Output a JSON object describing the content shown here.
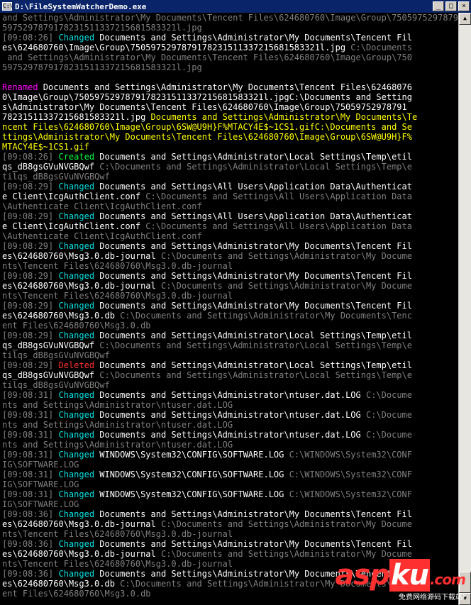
{
  "window": {
    "icon_text": "C:\\",
    "title": "D:\\FileSystemWatcherDemo.exe",
    "minimize": "_",
    "maximize": "□",
    "close": "×"
  },
  "colors": {
    "gray": "#808080",
    "white": "#ffffff",
    "cyan": "#00e0e0",
    "green": "#00ff40",
    "red": "#ff3030",
    "yellow": "#ffff00",
    "magenta": "#ff00ff"
  },
  "console_lines": [
    [
      [
        "gray",
        "and Settings\\Administrator\\My Documents\\Tencent Files\\624680760\\Image\\Group\\7505975297879178231511337215681583321"
      ]
    ],
    [
      [
        "gray",
        "5975297879178231511337215681583321l.jpg"
      ]
    ],
    [
      [
        "gray",
        "[09:08:26] "
      ],
      [
        "cyan",
        "Changed "
      ],
      [
        "white",
        "Documents and Settings\\Administrator\\My Documents\\Tencent Fil"
      ]
    ],
    [
      [
        "white",
        "es\\624680760\\Image\\Group\\7505975297879178231511337215681583321l.jpg "
      ],
      [
        "gray",
        "C:\\Documents"
      ]
    ],
    [
      [
        "gray",
        " and Settings\\Administrator\\My Documents\\Tencent Files\\624680760\\Image\\Group\\750"
      ]
    ],
    [
      [
        "gray",
        "5975297879178231511337215681583321l.jpg"
      ]
    ],
    [
      [
        "white",
        ""
      ]
    ],
    [
      [
        "magenta",
        "Renamed "
      ],
      [
        "white",
        "Documents and Settings\\Administrator\\My Documents\\Tencent Files\\62468076"
      ]
    ],
    [
      [
        "white",
        "0\\Image\\Group\\7505975297879178231511337215681583321l.jpgC:\\Documents and Setting"
      ]
    ],
    [
      [
        "white",
        "s\\Administrator\\My Documents\\Tencent Files\\624680760\\Image\\Group\\75059752978791"
      ]
    ],
    [
      [
        "white",
        "78231511337215681583321l.jpg "
      ],
      [
        "yellow",
        "Documents and Settings\\Administrator\\My Documents\\Te"
      ]
    ],
    [
      [
        "yellow",
        "ncent Files\\624680760\\Image\\Group\\6SW@U9H}F%MTACY4E$~1CS1.gifC:\\Documents and Se"
      ]
    ],
    [
      [
        "yellow",
        "ttings\\Administrator\\My Documents\\Tencent Files\\624680760\\Image\\Group\\6SW@U9H}F%"
      ]
    ],
    [
      [
        "yellow",
        "MTACY4E$~1CS1.gif"
      ]
    ],
    [
      [
        "gray",
        "[09:08:26] "
      ],
      [
        "green",
        "Created "
      ],
      [
        "white",
        "Documents and Settings\\Administrator\\Local Settings\\Temp\\etil"
      ]
    ],
    [
      [
        "white",
        "qs_dB8gsGVuNVGBQwf "
      ],
      [
        "gray",
        "C:\\Documents and Settings\\Administrator\\Local Settings\\Temp\\e"
      ]
    ],
    [
      [
        "gray",
        "tilqs_dB8gsGVuNVGBQwf"
      ]
    ],
    [
      [
        "gray",
        "[09:08:29] "
      ],
      [
        "cyan",
        "Changed "
      ],
      [
        "white",
        "Documents and Settings\\All Users\\Application Data\\Authenticat"
      ]
    ],
    [
      [
        "white",
        "e Client\\IcgAuthClient.conf "
      ],
      [
        "gray",
        "C:\\Documents and Settings\\All Users\\Application Data"
      ]
    ],
    [
      [
        "gray",
        "\\Authenticate Client\\IcgAuthClient.conf"
      ]
    ],
    [
      [
        "gray",
        "[09:08:29] "
      ],
      [
        "cyan",
        "Changed "
      ],
      [
        "white",
        "Documents and Settings\\All Users\\Application Data\\Authenticat"
      ]
    ],
    [
      [
        "white",
        "e Client\\IcgAuthClient.conf "
      ],
      [
        "gray",
        "C:\\Documents and Settings\\All Users\\Application Data"
      ]
    ],
    [
      [
        "gray",
        "\\Authenticate Client\\IcgAuthClient.conf"
      ]
    ],
    [
      [
        "gray",
        "[09:08:29] "
      ],
      [
        "cyan",
        "Changed "
      ],
      [
        "white",
        "Documents and Settings\\Administrator\\My Documents\\Tencent Fil"
      ]
    ],
    [
      [
        "white",
        "es\\624680760\\Msg3.0.db-journal "
      ],
      [
        "gray",
        "C:\\Documents and Settings\\Administrator\\My Docume"
      ]
    ],
    [
      [
        "gray",
        "nts\\Tencent Files\\624680760\\Msg3.0.db-journal"
      ]
    ],
    [
      [
        "gray",
        "[09:08:29] "
      ],
      [
        "cyan",
        "Changed "
      ],
      [
        "white",
        "Documents and Settings\\Administrator\\My Documents\\Tencent Fil"
      ]
    ],
    [
      [
        "white",
        "es\\624680760\\Msg3.0.db-journal "
      ],
      [
        "gray",
        "C:\\Documents and Settings\\Administrator\\My Docume"
      ]
    ],
    [
      [
        "gray",
        "nts\\Tencent Files\\624680760\\Msg3.0.db-journal"
      ]
    ],
    [
      [
        "gray",
        "[09:08:29] "
      ],
      [
        "cyan",
        "Changed "
      ],
      [
        "white",
        "Documents and Settings\\Administrator\\My Documents\\Tencent Fil"
      ]
    ],
    [
      [
        "white",
        "es\\624680760\\Msg3.0.db "
      ],
      [
        "gray",
        "C:\\Documents and Settings\\Administrator\\My Documents\\Tenc"
      ]
    ],
    [
      [
        "gray",
        "ent Files\\624680760\\Msg3.0.db"
      ]
    ],
    [
      [
        "gray",
        "[09:08:29] "
      ],
      [
        "cyan",
        "Changed "
      ],
      [
        "white",
        "Documents and Settings\\Administrator\\Local Settings\\Temp\\etil"
      ]
    ],
    [
      [
        "white",
        "qs_dB8gsGVuNVGBQwf "
      ],
      [
        "gray",
        "C:\\Documents and Settings\\Administrator\\Local Settings\\Temp\\e"
      ]
    ],
    [
      [
        "gray",
        "tilqs_dB8gsGVuNVGBQwf"
      ]
    ],
    [
      [
        "gray",
        "[09:08:29] "
      ],
      [
        "red",
        "Deleted "
      ],
      [
        "white",
        "Documents and Settings\\Administrator\\Local Settings\\Temp\\etil"
      ]
    ],
    [
      [
        "white",
        "qs_dB8gsGVuNVGBQwf "
      ],
      [
        "gray",
        "C:\\Documents and Settings\\Administrator\\Local Settings\\Temp\\e"
      ]
    ],
    [
      [
        "gray",
        "tilqs_dB8gsGVuNVGBQwf"
      ]
    ],
    [
      [
        "gray",
        "[09:08:31] "
      ],
      [
        "cyan",
        "Changed "
      ],
      [
        "white",
        "Documents and Settings\\Administrator\\ntuser.dat.LOG "
      ],
      [
        "gray",
        "C:\\Docume"
      ]
    ],
    [
      [
        "gray",
        "nts and Settings\\Administrator\\ntuser.dat.LOG"
      ]
    ],
    [
      [
        "gray",
        "[09:08:31] "
      ],
      [
        "cyan",
        "Changed "
      ],
      [
        "white",
        "Documents and Settings\\Administrator\\ntuser.dat.LOG "
      ],
      [
        "gray",
        "C:\\Docume"
      ]
    ],
    [
      [
        "gray",
        "nts and Settings\\Administrator\\ntuser.dat.LOG"
      ]
    ],
    [
      [
        "gray",
        "[09:08:31] "
      ],
      [
        "cyan",
        "Changed "
      ],
      [
        "white",
        "Documents and Settings\\Administrator\\ntuser.dat.LOG "
      ],
      [
        "gray",
        "C:\\Docume"
      ]
    ],
    [
      [
        "gray",
        "nts and Settings\\Administrator\\ntuser.dat.LOG"
      ]
    ],
    [
      [
        "gray",
        "[09:08:31] "
      ],
      [
        "cyan",
        "Changed "
      ],
      [
        "white",
        "WINDOWS\\System32\\CONFIG\\SOFTWARE.LOG "
      ],
      [
        "gray",
        "C:\\WINDOWS\\System32\\CONF"
      ]
    ],
    [
      [
        "gray",
        "IG\\SOFTWARE.LOG"
      ]
    ],
    [
      [
        "gray",
        "[09:08:31] "
      ],
      [
        "cyan",
        "Changed "
      ],
      [
        "white",
        "WINDOWS\\System32\\CONFIG\\SOFTWARE.LOG "
      ],
      [
        "gray",
        "C:\\WINDOWS\\System32\\CONF"
      ]
    ],
    [
      [
        "gray",
        "IG\\SOFTWARE.LOG"
      ]
    ],
    [
      [
        "gray",
        "[09:08:31] "
      ],
      [
        "cyan",
        "Changed "
      ],
      [
        "white",
        "WINDOWS\\System32\\CONFIG\\SOFTWARE.LOG "
      ],
      [
        "gray",
        "C:\\WINDOWS\\System32\\CONF"
      ]
    ],
    [
      [
        "gray",
        "IG\\SOFTWARE.LOG"
      ]
    ],
    [
      [
        "gray",
        "[09:08:36] "
      ],
      [
        "cyan",
        "Changed "
      ],
      [
        "white",
        "Documents and Settings\\Administrator\\My Documents\\Tencent Fil"
      ]
    ],
    [
      [
        "white",
        "es\\624680760\\Msg3.0.db-journal "
      ],
      [
        "gray",
        "C:\\Documents and Settings\\Administrator\\My Docume"
      ]
    ],
    [
      [
        "gray",
        "nts\\Tencent Files\\624680760\\Msg3.0.db-journal"
      ]
    ],
    [
      [
        "gray",
        "[09:08:36] "
      ],
      [
        "cyan",
        "Changed "
      ],
      [
        "white",
        "Documents and Settings\\Administrator\\My Documents\\Tencent Fil"
      ]
    ],
    [
      [
        "white",
        "es\\624680760\\Msg3.0.db-journal "
      ],
      [
        "gray",
        "C:\\Documents and Settings\\Administrator\\My Docume"
      ]
    ],
    [
      [
        "gray",
        "nts\\Tencent Files\\624680760\\Msg3.0.db-journal"
      ]
    ],
    [
      [
        "gray",
        "[09:08:36] "
      ],
      [
        "cyan",
        "Changed "
      ],
      [
        "white",
        "Documents and Settings\\Administrator\\My Documents\\Tencent Fil"
      ]
    ],
    [
      [
        "white",
        "es\\624680760\\Msg3.0.db "
      ],
      [
        "gray",
        "C:\\Documents and Settings\\Administrator\\My Documents\\Tenc"
      ]
    ],
    [
      [
        "gray",
        "ent Files\\624680760\\Msg3.0.db"
      ]
    ]
  ],
  "scrollbar": {
    "up_arrow": "▲",
    "down_arrow": "▼"
  },
  "watermark": {
    "logo_a": "asp",
    "logo_b": "ku",
    "logo_c": ".com",
    "subtitle": "免费网络源码下载站!"
  }
}
